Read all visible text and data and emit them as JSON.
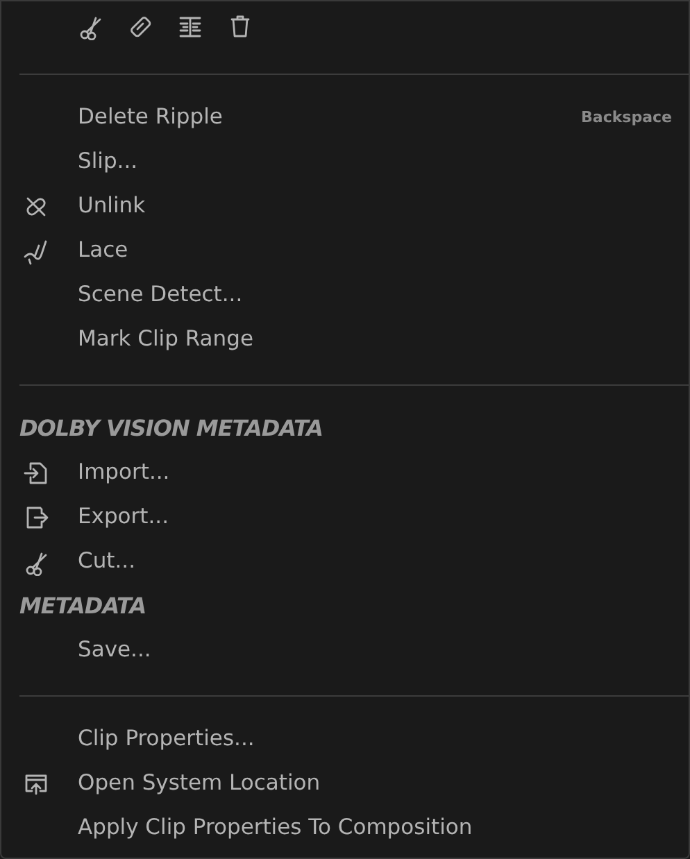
{
  "toolbar": {
    "buttons": [
      {
        "kind": "scissors"
      },
      {
        "kind": "blade"
      },
      {
        "kind": "split"
      },
      {
        "kind": "trash"
      }
    ]
  },
  "menu": [
    {
      "kind": "separator"
    },
    {
      "kind": "item",
      "label": "Delete Ripple",
      "shortcut": "Backspace"
    },
    {
      "kind": "item",
      "label": "Slip..."
    },
    {
      "kind": "item",
      "label": "Unlink"
    },
    {
      "kind": "item",
      "label": "Lace"
    },
    {
      "kind": "item",
      "label": "Scene Detect..."
    },
    {
      "kind": "item",
      "label": "Mark Clip Range"
    },
    {
      "kind": "separator"
    },
    {
      "kind": "header",
      "label": "DOLBY VISION METADATA"
    },
    {
      "kind": "item",
      "label": "Import..."
    },
    {
      "kind": "item",
      "label": "Export..."
    },
    {
      "kind": "item",
      "label": "Cut..."
    },
    {
      "kind": "header",
      "label": "METADATA"
    },
    {
      "kind": "item",
      "label": "Save..."
    },
    {
      "kind": "separator"
    },
    {
      "kind": "item",
      "label": "Clip Properties..."
    },
    {
      "kind": "item",
      "label": "Open System Location"
    },
    {
      "kind": "item",
      "label": "Apply Clip Properties To Composition"
    }
  ]
}
